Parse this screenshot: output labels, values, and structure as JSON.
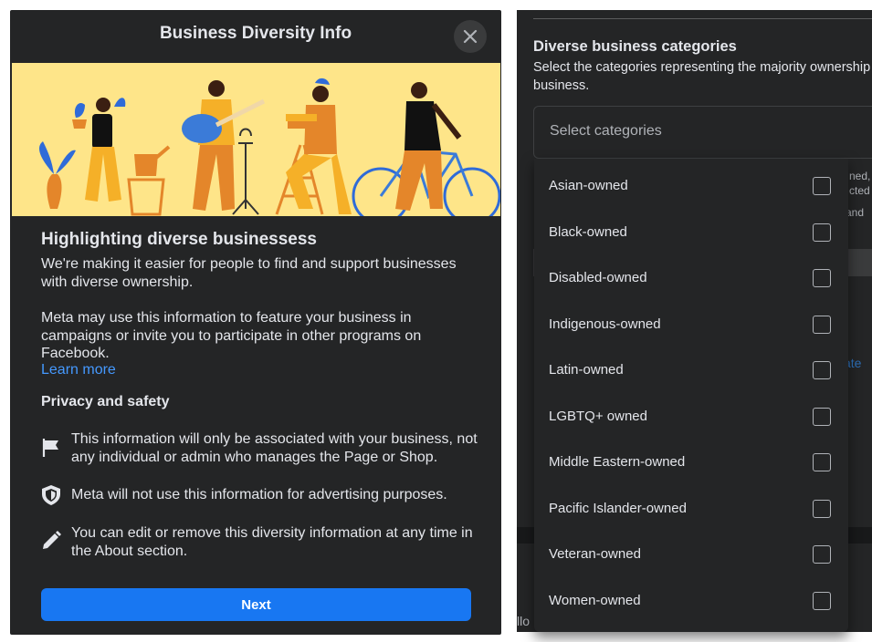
{
  "dialog": {
    "title": "Business Diversity Info",
    "heading": "Highlighting diverse businessess",
    "paragraph1": "We're making it easier for people to find and support businesses with diverse ownership.",
    "paragraph2": "Meta may use this information to feature your business in campaigns or invite you to participate in other programs on Facebook.",
    "learn_more": "Learn more",
    "privacy_heading": "Privacy and safety",
    "privacy_items": [
      {
        "icon": "flag-icon",
        "text": "This information will only be associated with your business, not any individual or admin who manages the Page or Shop."
      },
      {
        "icon": "shield-icon",
        "text": "Meta will not use this information for advertising purposes."
      },
      {
        "icon": "pencil-icon",
        "text": "You can edit or remove this diversity information at any time in the About section."
      }
    ],
    "next_label": "Next"
  },
  "panel": {
    "heading": "Diverse business categories",
    "description": "Select the categories representing the majority ownership of your business.",
    "select_placeholder": "Select categories",
    "fragments": {
      "f1_line1": "ned,",
      "f1_line2": "cted",
      "f2": "and",
      "f3": "ate",
      "f4": "llo"
    }
  },
  "dropdown": {
    "options": [
      "Asian-owned",
      "Black-owned",
      "Disabled-owned",
      "Indigenous-owned",
      "Latin-owned",
      "LGBTQ+ owned",
      "Middle Eastern-owned",
      "Pacific Islander-owned",
      "Veteran-owned",
      "Women-owned"
    ]
  },
  "colors": {
    "accent": "#1877f2",
    "link": "#4599ff",
    "surface": "#242526",
    "banner": "#fee589"
  }
}
